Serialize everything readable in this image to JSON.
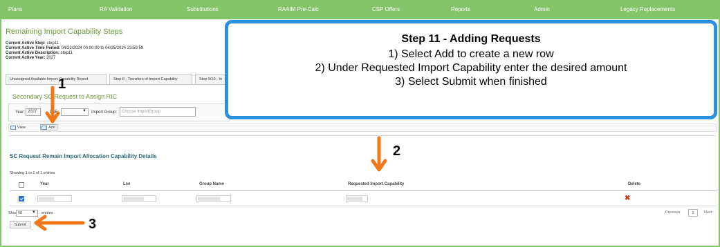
{
  "nav": {
    "items": [
      "Plans",
      "RA Validation",
      "Substitutions",
      "RAAIM Pre-Calc",
      "CSP Offers",
      "Reports",
      "Admin",
      "Legacy Replacements"
    ]
  },
  "header": {
    "title": "Remaining Import Capability Steps",
    "active_step_label": "Current Active Step:",
    "active_step_value": "step11",
    "time_period_label": "Current Active Time Period:",
    "time_period_value": "04/22/2024 00:00:00 to 04/25/2024 23:59:59",
    "description_label": "Current Active Description:",
    "description_value": "step11",
    "year_label": "Current Active Year:",
    "year_value": "2027"
  },
  "tabs": [
    "Unassigned Available Import Capability Report",
    "Step 8 - Transfers of Import Capability",
    "Step 9/10 - In"
  ],
  "filter": {
    "section_title": "Secondary SC Request to Assign RIC",
    "year_label": "Year:",
    "year_value": "2027",
    "lse_label": "LSE:",
    "import_group_label": "Import Group:",
    "import_group_placeholder": "Choose ImportGroup"
  },
  "toolbar": {
    "view_label": "View",
    "add_label": "Add"
  },
  "details": {
    "title": "SC Request Remain Import Allocation Capability Details",
    "showing": "Showing 1 to 1 of 1 entries",
    "columns": [
      "Year",
      "Lse",
      "Group Name",
      "Requested Import Capability",
      "Delete"
    ],
    "row_checked": true
  },
  "footer": {
    "show_label": "Show",
    "show_value": "50",
    "entries_label": "entries",
    "submit_label": "Submit",
    "previous_label": "Previous",
    "page_number": "1",
    "next_label": "Next"
  },
  "callout": {
    "title": "Step 11 - Adding Requests",
    "lines": [
      "1) Select Add to create a new row",
      "2) Under Requested Import Capability enter the desired amount",
      "3) Select Submit when finished"
    ]
  },
  "annotations": {
    "n1": "1",
    "n2": "2",
    "n3": "3",
    "arrow_color": "#f07818"
  },
  "colors": {
    "nav_bg": "#86c46a",
    "title_green": "#6a9a3a",
    "callout_border": "#2c8fe0",
    "delete_red": "#d03a1a"
  }
}
